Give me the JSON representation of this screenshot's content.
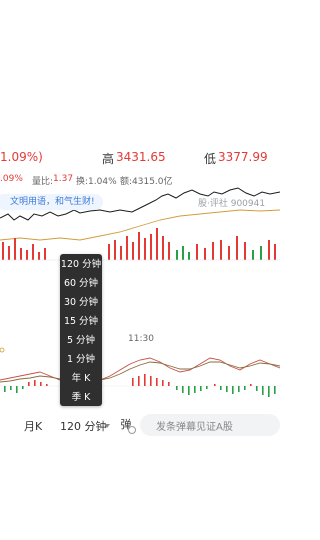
{
  "stats": {
    "change_pct": "1.09%)",
    "high_label": "高",
    "high_value": "3431.65",
    "low_label": "低",
    "low_value": "3377.99"
  },
  "info": {
    "pct": ".09%",
    "volume_ratio_label": "量比:",
    "volume_ratio_value": "1.37",
    "turnover": "换:1.04%",
    "amount": "额:4315.0亿"
  },
  "bubble_text": "文明用语，和气生财!",
  "watermark": "股·评社 900941",
  "time_label": "11:30",
  "period_menu": [
    "120 分钟",
    "60 分钟",
    "30 分钟",
    "15 分钟",
    "5 分钟",
    "1 分钟",
    "年 K",
    "季 K"
  ],
  "bottom_bar": {
    "month_k": "月K",
    "selected_period": "120 分钟",
    "danmu_icon": "弹",
    "danmu_placeholder": "发条弹幕见证A股"
  },
  "colors": {
    "up": "#e53935",
    "down": "#27a046",
    "price_line": "#1a1a1a",
    "avg_line": "#d39b3a",
    "macd_dif": "#c4524a",
    "macd_dea": "#8a6d3b"
  },
  "icons": {
    "danmu": "danmu-icon",
    "dropdown": "caret-down-icon"
  }
}
